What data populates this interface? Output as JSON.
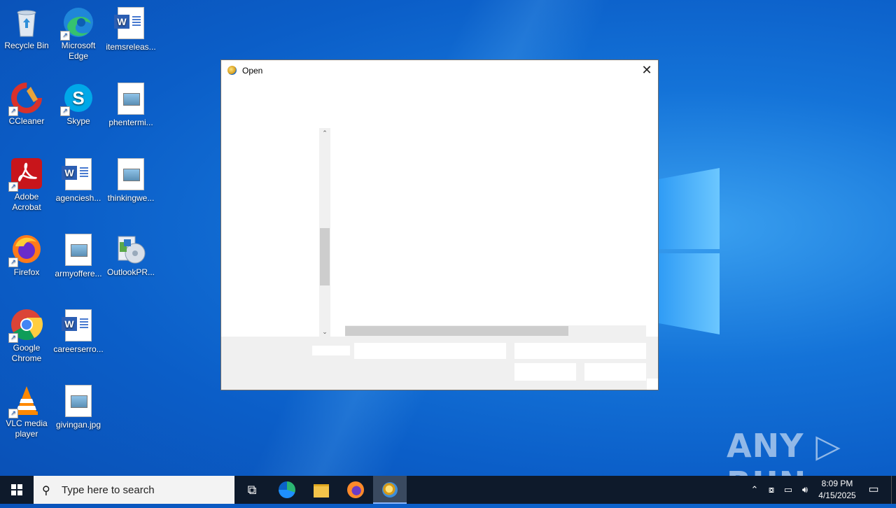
{
  "desktop": {
    "icons": [
      {
        "label": "Recycle Bin",
        "icon": "recycle-bin-icon"
      },
      {
        "label": "Microsoft Edge",
        "icon": "edge-icon"
      },
      {
        "label": "itemsreleas...",
        "icon": "word-doc-icon"
      },
      {
        "label": "CCleaner",
        "icon": "ccleaner-icon"
      },
      {
        "label": "Skype",
        "icon": "skype-icon"
      },
      {
        "label": "phentermi...",
        "icon": "image-file-icon"
      },
      {
        "label": "Adobe Acrobat",
        "icon": "acrobat-icon"
      },
      {
        "label": "agenciesh...",
        "icon": "word-doc-icon"
      },
      {
        "label": "thinkingwe...",
        "icon": "image-file-icon"
      },
      {
        "label": "Firefox",
        "icon": "firefox-icon"
      },
      {
        "label": "armyoffere...",
        "icon": "image-file-icon"
      },
      {
        "label": "OutlookPR...",
        "icon": "installer-icon"
      },
      {
        "label": "Google Chrome",
        "icon": "chrome-icon"
      },
      {
        "label": "careerserro...",
        "icon": "word-doc-icon"
      },
      {
        "label": "VLC media player",
        "icon": "vlc-icon"
      },
      {
        "label": "givingan.jpg",
        "icon": "image-file-icon"
      }
    ]
  },
  "dialog": {
    "title": "Open",
    "close_glyph": "✕",
    "scroll_up_glyph": "⌃",
    "scroll_down_glyph": "⌄"
  },
  "watermark": "ANY ▷ RUN",
  "taskbar": {
    "search_placeholder": "Type here to search",
    "time": "8:09 PM",
    "date": "4/15/2025",
    "colors": {
      "bar": "#0e1a2b",
      "desktop": "#0b5ec8"
    }
  }
}
